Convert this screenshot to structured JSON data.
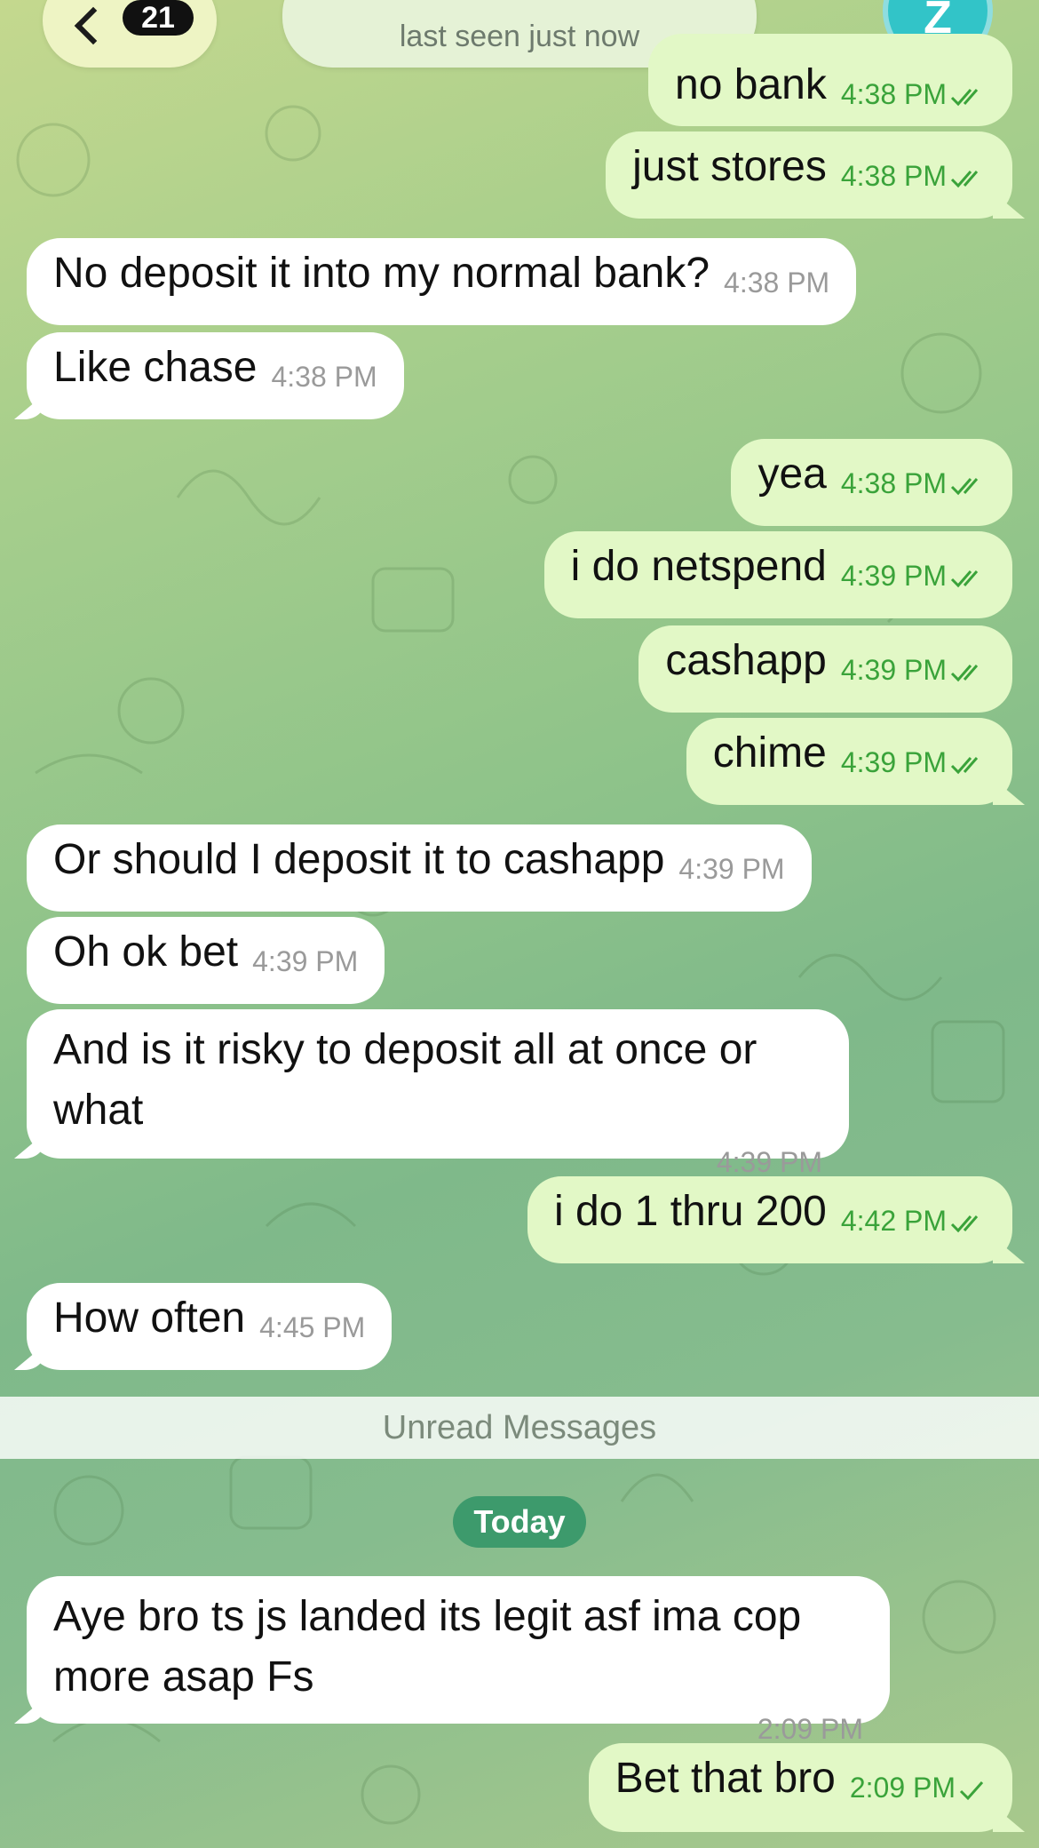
{
  "header": {
    "back_badge": "21",
    "contact_name": "Z",
    "status": "last seen just now",
    "avatar_letter": "Z"
  },
  "messages": [
    {
      "dir": "out",
      "text": "no bank",
      "time": "4:38 PM",
      "status": "read"
    },
    {
      "dir": "out",
      "text": "just stores",
      "time": "4:38 PM",
      "status": "read"
    },
    {
      "dir": "in",
      "text": "No deposit it into my normal bank?",
      "time": "4:38 PM"
    },
    {
      "dir": "in",
      "text": "Like chase",
      "time": "4:38 PM"
    },
    {
      "dir": "out",
      "text": "yea",
      "time": "4:38 PM",
      "status": "read"
    },
    {
      "dir": "out",
      "text": "i do netspend",
      "time": "4:39 PM",
      "status": "read"
    },
    {
      "dir": "out",
      "text": "cashapp",
      "time": "4:39 PM",
      "status": "read"
    },
    {
      "dir": "out",
      "text": "chime",
      "time": "4:39 PM",
      "status": "read"
    },
    {
      "dir": "in",
      "text": "Or should I deposit it to cashapp",
      "time": "4:39 PM"
    },
    {
      "dir": "in",
      "text": "Oh ok bet",
      "time": "4:39 PM"
    },
    {
      "dir": "in",
      "text": "And is it risky to deposit all at once or what",
      "time": "4:39 PM"
    },
    {
      "dir": "out",
      "text": "i do 1 thru 200",
      "time": "4:42 PM",
      "status": "read"
    },
    {
      "dir": "in",
      "text": "How often",
      "time": "4:45 PM"
    },
    {
      "dir": "in",
      "text": "Aye bro ts js landed its legit asf ima cop more asap Fs",
      "time": "2:09 PM"
    },
    {
      "dir": "out",
      "text": "Bet that bro",
      "time": "2:09 PM",
      "status": "sent"
    }
  ],
  "unread_label": "Unread Messages",
  "date_label": "Today",
  "colors": {
    "incoming_bubble": "#ffffff",
    "outgoing_bubble": "#e2f8c6",
    "outgoing_time": "#3aa33a",
    "date_pill": "#3d9a6c"
  }
}
